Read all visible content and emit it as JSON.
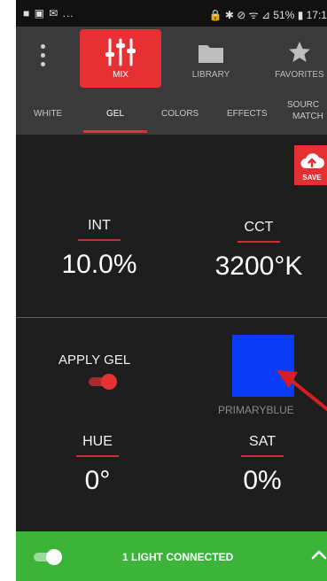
{
  "status": {
    "left_icons": "■ ▣ ✉ ...",
    "right_text": "🔒 ✱ ⊘ ᯤ ⊿ 51% ▮ 17:1"
  },
  "nav": {
    "mix": "MIX",
    "library": "LIBRARY",
    "favorites": "FAVORITES"
  },
  "subtabs": {
    "white": "WHITE",
    "gel": "GEL",
    "colors": "COLORS",
    "effects": "EFFECTS",
    "source_line1": "SOURC",
    "source_line2": "MATCH"
  },
  "save": {
    "label": "SAVE"
  },
  "int": {
    "title": "INT",
    "value": "10.0%"
  },
  "cct": {
    "title": "CCT",
    "value": "3200°K"
  },
  "gel": {
    "apply_label": "APPLY GEL",
    "apply_on": true,
    "swatch_color": "#0b3cf5",
    "swatch_name": "PRIMARYBLUE"
  },
  "hue": {
    "title": "HUE",
    "value": "0°"
  },
  "sat": {
    "title": "SAT",
    "value": "0%"
  },
  "bottom": {
    "text": "1 LIGHT CONNECTED",
    "toggle_on": true
  },
  "colors": {
    "accent": "#e53034",
    "connected": "#3cb43a"
  }
}
